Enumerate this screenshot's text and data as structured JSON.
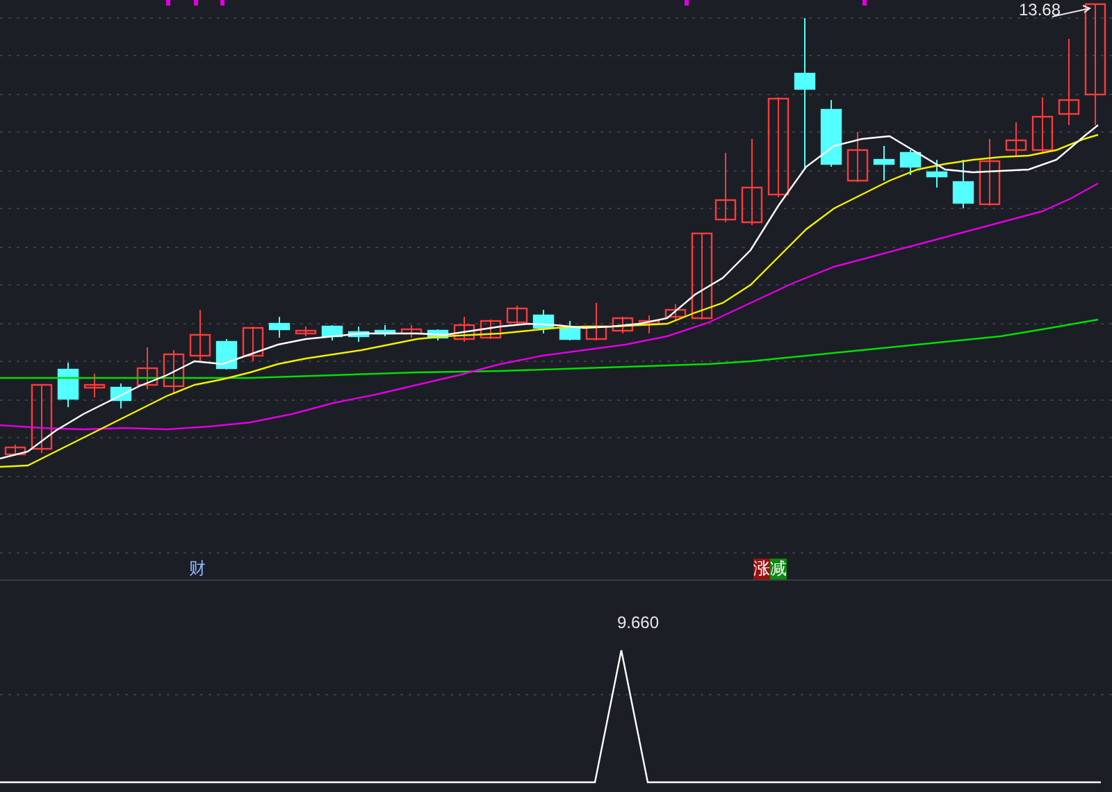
{
  "price_panel": {
    "high_label": "13.68"
  },
  "indicator_tags": [
    {
      "text": "财",
      "kind": "plain"
    },
    {
      "text": "涨",
      "kind": "rise"
    },
    {
      "text": "减",
      "kind": "fall"
    }
  ],
  "indicator_panel": {
    "peak_label": "9.660"
  }
}
